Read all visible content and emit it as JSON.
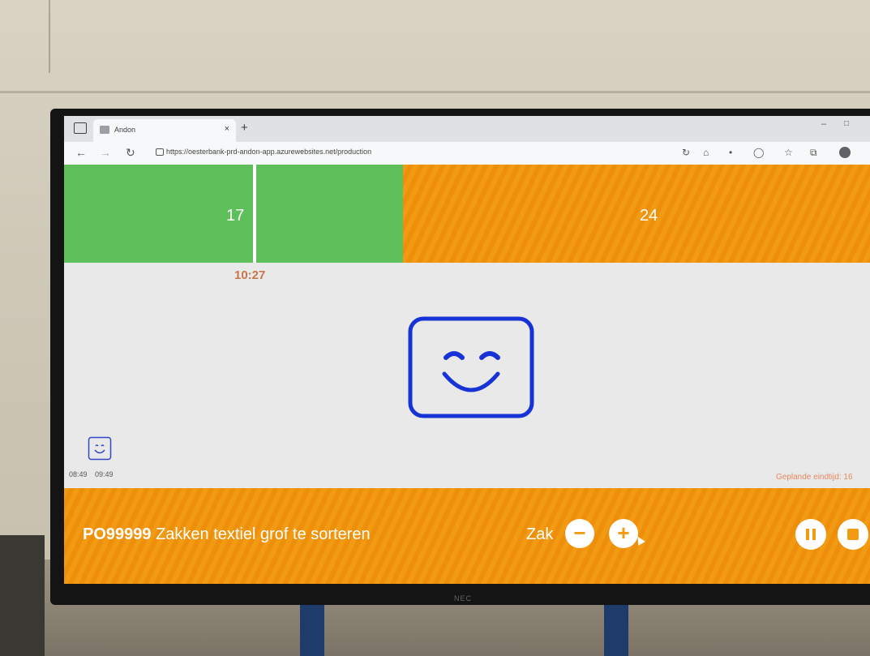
{
  "browser": {
    "tab_title": "Andon",
    "tab_close": "×",
    "new_tab": "+",
    "url": "https://oesterbank-prd-andon-app.azurewebsites.net/production"
  },
  "timeline": {
    "segments": [
      {
        "value": "17",
        "status": "good",
        "color": "#5ec05b"
      },
      {
        "value": "24",
        "status": "warning",
        "color": "#f29a12"
      }
    ],
    "current_time": "10:27"
  },
  "status": {
    "mood_icon": "smiley-face-icon",
    "color": "#1733d6"
  },
  "history": {
    "mood_icon": "smiley-face-icon",
    "start_time": "08:49",
    "end_time": "09:49"
  },
  "planned_end": "Geplande eindtijd: 16",
  "production": {
    "order_code": "PO99999",
    "order_description": "Zakken textiel grof te sorteren",
    "unit": "Zak",
    "decrement_label": "−",
    "increment_label": "+",
    "pause_icon": "pause-icon",
    "stop_icon": "stop-icon"
  },
  "monitor_brand": "NEC"
}
